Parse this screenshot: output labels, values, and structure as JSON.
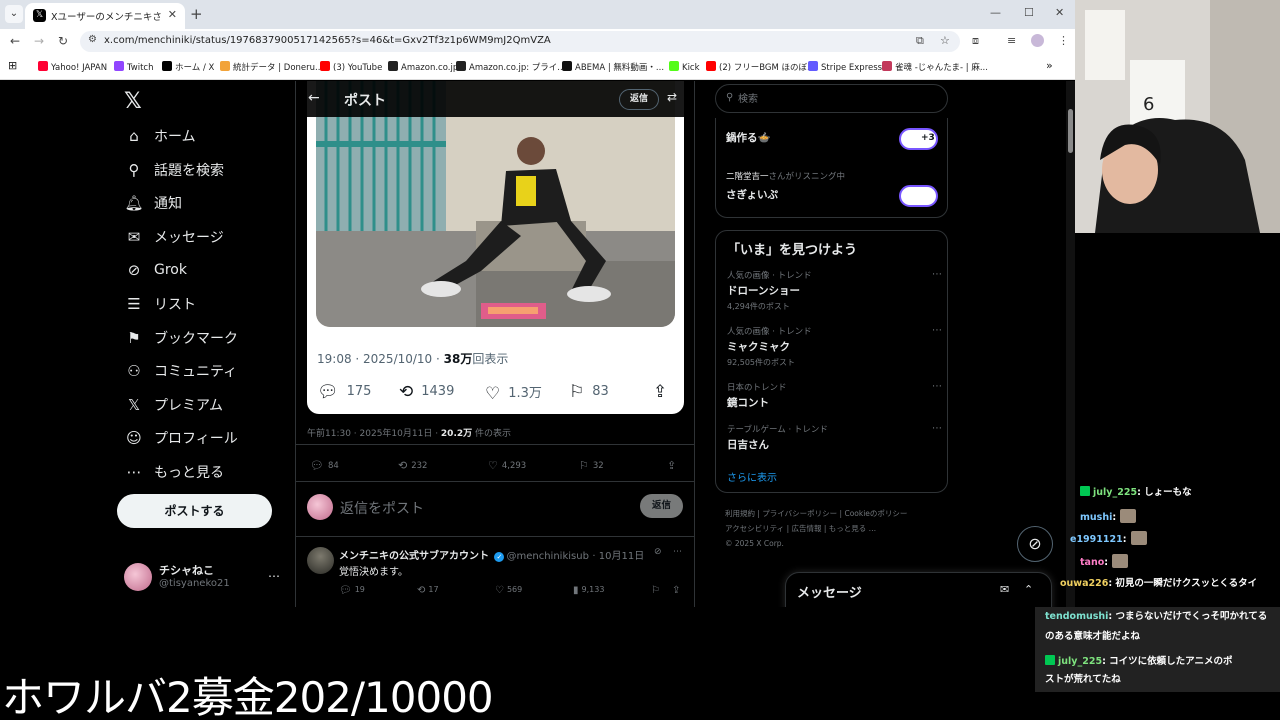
{
  "browser": {
    "tab_title": "Xユーザーのメンチニキさん:「まって",
    "url": "x.com/menchiniki/status/1976837900517142565?s=46&t=Gxv2Tf3z1p6WM9mJ2QmVZA",
    "bookmarks": [
      {
        "label": "Yahoo! JAPAN",
        "color": "#ff0033"
      },
      {
        "label": "Twitch",
        "color": "#9146ff"
      },
      {
        "label": "ホーム / X",
        "color": "#000000"
      },
      {
        "label": "統計データ | Doneru...",
        "color": "#f2a33a"
      },
      {
        "label": "(3) YouTube",
        "color": "#ff0000"
      },
      {
        "label": "Amazon.co.jp",
        "color": "#222222"
      },
      {
        "label": "Amazon.co.jp: プライ...",
        "color": "#222222"
      },
      {
        "label": "ABEMA | 無料動画・...",
        "color": "#111111"
      },
      {
        "label": "Kick",
        "color": "#53fc18"
      },
      {
        "label": "(2) フリーBGM ほのぼ...",
        "color": "#ff0000"
      },
      {
        "label": "Stripe Express",
        "color": "#635bff"
      },
      {
        "label": "雀魂 -じゃんたま- | 麻...",
        "color": "#c2395b"
      }
    ]
  },
  "x_nav": {
    "items": [
      {
        "icon": "⌂",
        "icon_name": "home-icon",
        "label": "ホーム",
        "key": "home"
      },
      {
        "icon": "⚲",
        "icon_name": "search-icon",
        "label": "話題を検索",
        "key": "explore"
      },
      {
        "icon": "🔔︎",
        "icon_name": "bell-icon",
        "label": "通知",
        "key": "notifications"
      },
      {
        "icon": "✉",
        "icon_name": "mail-icon",
        "label": "メッセージ",
        "key": "messages"
      },
      {
        "icon": "⊘",
        "icon_name": "grok-icon",
        "label": "Grok",
        "key": "grok"
      },
      {
        "icon": "☰",
        "icon_name": "list-icon",
        "label": "リスト",
        "key": "lists"
      },
      {
        "icon": "⚑",
        "icon_name": "bookmark-icon",
        "label": "ブックマーク",
        "key": "bookmarks"
      },
      {
        "icon": "⚇",
        "icon_name": "communities-icon",
        "label": "コミュニティ",
        "key": "communities"
      },
      {
        "icon": "𝕏",
        "icon_name": "premium-icon",
        "label": "プレミアム",
        "key": "premium"
      },
      {
        "icon": "☺",
        "icon_name": "profile-icon",
        "label": "プロフィール",
        "key": "profile"
      },
      {
        "icon": "⋯",
        "icon_name": "more-icon",
        "label": "もっと見る",
        "key": "more"
      }
    ],
    "post_button": "ポストする",
    "account_name": "チシャねこ",
    "account_handle": "@tisyaneko21"
  },
  "main": {
    "header_title": "ポスト",
    "header_reply": "返信",
    "card": {
      "time": "19:08 · 2025/10/10 · ",
      "views_bold": "38万",
      "views_suffix": "回表示",
      "replies": "175",
      "reposts": "1439",
      "likes": "1.3万",
      "bookmarks": "83"
    },
    "post_meta_prefix": "午前11:30 · 2025年10月11日 · ",
    "post_meta_views": "20.2万",
    "post_meta_suffix": " 件の表示",
    "stats": {
      "replies": "84",
      "reposts": "232",
      "likes": "4,293",
      "bookmarks": "32"
    },
    "compose_placeholder": "返信をポスト",
    "compose_button": "返信",
    "reply": {
      "name": "メンチニキの公式サブアカウント",
      "handle": "@menchinikisub",
      "date": "· 10月11日",
      "text": "覚悟決めます。",
      "replies": "19",
      "reposts": "17",
      "likes": "569",
      "views": "9,133"
    }
  },
  "right": {
    "search_placeholder": "検索",
    "space1_title": "鍋作る🍲",
    "space1_plus": "+3",
    "space2_host": "二階堂吉一",
    "space2_host_suffix": "さんがリスニング中",
    "space2_title": "さぎょいぷ",
    "trends_title": "「いま」を見つけよう",
    "trends": [
      {
        "context": "人気の画像 · トレンド",
        "name": "ドローンショー",
        "count": "4,294件のポスト"
      },
      {
        "context": "人気の画像 · トレンド",
        "name": "ミャクミャク",
        "count": "92,505件のポスト"
      },
      {
        "context": "日本のトレンド",
        "name": "鏡コント",
        "count": ""
      },
      {
        "context": "テーブルゲーム · トレンド",
        "name": "日吉さん",
        "count": ""
      }
    ],
    "show_more": "さらに表示",
    "footer": [
      "利用規約",
      "プライバシーポリシー",
      "Cookieのポリシー",
      "アクセシビリティ",
      "広告情報",
      "もっと見る …",
      "© 2025 X Corp."
    ],
    "messages_title": "メッセージ"
  },
  "chat": {
    "lines": [
      {
        "user": "july_225",
        "user_color": "#7ee27e",
        "text": ": しょーもな"
      },
      {
        "user": "mushi",
        "user_color": "#7ec8ff",
        "text": ":"
      },
      {
        "user": "e1991121",
        "user_color": "#7ec8ff",
        "text": ":"
      },
      {
        "user": "tano",
        "user_color": "#ff7ec8",
        "text": ":"
      },
      {
        "user": "ouwa226",
        "user_color": "#f0d060",
        "text": ": 初見の一瞬だけクスッとくるタイ"
      },
      {
        "user": "tendomushi",
        "user_color": "#7ee2d0",
        "text": ": つまらないだけでくっそ叩かれてる"
      },
      {
        "user": "",
        "user_color": "#ffffff",
        "text": "のある意味才能だよね"
      },
      {
        "user": "july_225",
        "user_color": "#7ee27e",
        "text": ": コイツに依頼したアニメのポ"
      },
      {
        "user": "",
        "user_color": "#ffffff",
        "text": "ストが荒れてたね"
      }
    ]
  },
  "caption": "ホワルバ2募金202/10000"
}
